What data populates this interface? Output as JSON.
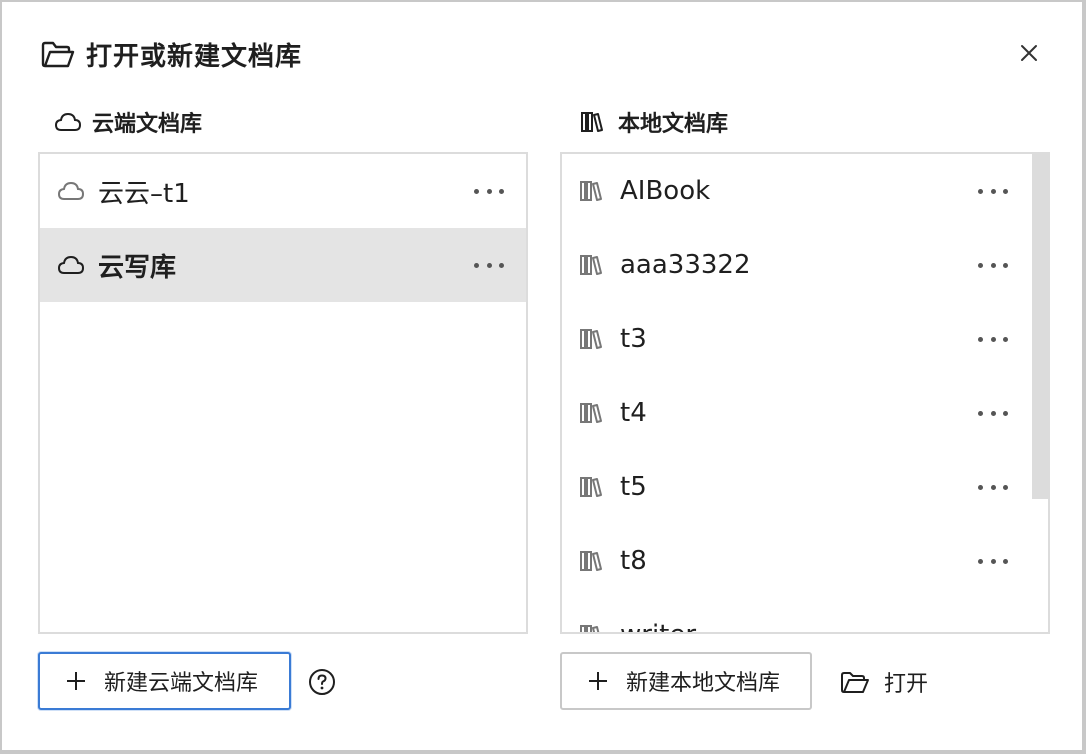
{
  "dialog": {
    "title": "打开或新建文档库",
    "title_icon": "folder-open-icon",
    "close_icon": "close-icon"
  },
  "cloud": {
    "header": "云端文档库",
    "header_icon": "cloud-icon",
    "items": [
      {
        "label": "云云–t1",
        "selected": false
      },
      {
        "label": "云写库",
        "selected": true
      }
    ],
    "new_button": "新建云端文档库"
  },
  "local": {
    "header": "本地文档库",
    "header_icon": "books-icon",
    "items": [
      {
        "label": "AIBook"
      },
      {
        "label": "aaa33322"
      },
      {
        "label": "t3"
      },
      {
        "label": "t4"
      },
      {
        "label": "t5"
      },
      {
        "label": "t8"
      },
      {
        "label": "writer"
      }
    ],
    "new_button": "新建本地文档库",
    "open_button": "打开"
  },
  "colors": {
    "accent": "#3a7bd5",
    "selected_row": "#e4e4e4",
    "border": "#dcdcdc"
  }
}
